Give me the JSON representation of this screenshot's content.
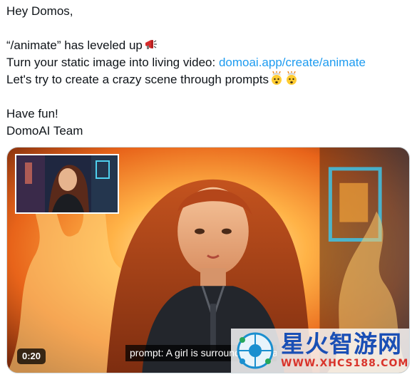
{
  "tweet": {
    "greeting": "Hey Domos,",
    "line2": " “/animate” has leveled up",
    "line2_emoji": "megaphone-icon",
    "line3_prefix": "Turn your static image into living video: ",
    "line3_link": "domoai.app/create/animate",
    "line4": "Let's try to create a crazy scene through prompts",
    "line4_emoji": "exploding-head-icon",
    "line6": "Have fun!",
    "line7": "DomoAI Team"
  },
  "media": {
    "duration": "0:20",
    "caption": "prompt: A girl is surrounded by flames",
    "thumbnail_icon": "video-thumbnail",
    "watermark": {
      "title": "星火智游网",
      "url": "WWW.XHCS188.COM"
    }
  },
  "colors": {
    "link": "#1d9bf0",
    "text": "#0f1419",
    "watermark_title": "#1a4fb5",
    "watermark_url": "#d9342b"
  }
}
